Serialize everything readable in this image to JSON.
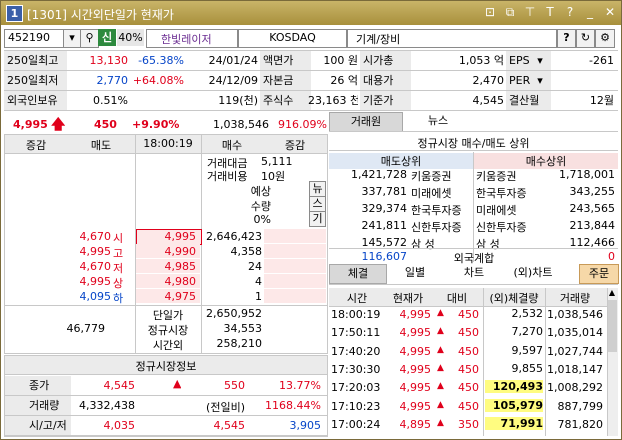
{
  "title": {
    "number": "1",
    "text": "[1301] 시간외단일가 현재가"
  },
  "toolbar": {
    "code": "452190",
    "sin": "신",
    "ratio": "40%",
    "stock_name": "한빛레이저",
    "market": "KOSDAQ",
    "sector": "기계/장비",
    "help": "?"
  },
  "summary": {
    "rows": [
      {
        "label": "250일최고",
        "price": "13,130",
        "pct": "-65.38%",
        "date": "24/01/24",
        "k1": "액면가",
        "v1": "100 원",
        "k2": "시가총",
        "v2": "1,053 억",
        "k3": "EPS",
        "v3": "-261"
      },
      {
        "label": "250일최저",
        "price": "2,770",
        "pct": "+64.08%",
        "date": "24/12/09",
        "k1": "자본금",
        "v1": "26 억",
        "k2": "대용가",
        "v2": "2,470",
        "k3": "PER",
        "v3": ""
      },
      {
        "label": "외국인보유",
        "price": "0.51%",
        "pct": "",
        "date": "119(천)",
        "k1": "주식수",
        "v1": "23,163 천",
        "k2": "기준가",
        "v2": "4,545",
        "k3": "결산월",
        "v3": "12월"
      }
    ]
  },
  "quote": {
    "price": "4,995",
    "change": "450",
    "rate": "+9.90%",
    "volume": "1,038,546",
    "vol_ratio": "916.09%"
  },
  "orderbook": {
    "headers": [
      "증감",
      "매도",
      "18:00:19",
      "매수",
      "증감"
    ],
    "amount_label": "거래대금",
    "amount": "5,111",
    "cost_label": "거래비용",
    "cost": "10원",
    "expected_labels": [
      "예상",
      "수량",
      "0%"
    ],
    "side_buttons": [
      "뉴",
      "스",
      "기"
    ],
    "stats": [
      {
        "value": "4,670",
        "label": "시"
      },
      {
        "value": "4,995",
        "label": "고"
      },
      {
        "value": "4,670",
        "label": "저"
      },
      {
        "value": "4,995",
        "label": "상"
      },
      {
        "value": "4,095",
        "label": "하"
      }
    ],
    "levels": [
      {
        "price": "4,995",
        "qty": "2,646,423"
      },
      {
        "price": "4,990",
        "qty": "4,358"
      },
      {
        "price": "4,985",
        "qty": "24"
      },
      {
        "price": "4,980",
        "qty": "4"
      },
      {
        "price": "4,975",
        "qty": "1"
      }
    ],
    "total_ask": "46,779",
    "rows_bottom": [
      {
        "label": "단일가",
        "value": "2,650,952"
      },
      {
        "label": "정규시장",
        "value": "34,553"
      },
      {
        "label": "시간외",
        "value": "258,210"
      }
    ]
  },
  "regular": {
    "title": "정규시장정보",
    "rows": [
      {
        "label": "종가",
        "a": "4,545",
        "b": "550",
        "c": "13.77%"
      },
      {
        "label": "거래량",
        "a": "4,332,438",
        "b": "(전일비)",
        "c": "1168.44%"
      },
      {
        "label": "시/고/저",
        "a": "4,035",
        "b": "4,545",
        "c": "3,905"
      }
    ]
  },
  "broker": {
    "tabs": [
      "거래원",
      "뉴스"
    ],
    "subtitle": "정규시장 매수/매도 상위",
    "sell_header": "매도상위",
    "buy_header": "매수상위",
    "rows": [
      {
        "sv": "1,421,728",
        "sn": "키움증권",
        "bn": "키움증권",
        "bv": "1,718,001"
      },
      {
        "sv": "337,781",
        "sn": "미래에셋",
        "bn": "한국투자증",
        "bv": "343,255"
      },
      {
        "sv": "329,374",
        "sn": "한국투자증",
        "bn": "미래에셋",
        "bv": "243,565"
      },
      {
        "sv": "241,811",
        "sn": "신한투자증",
        "bn": "신한투자증",
        "bv": "213,844"
      },
      {
        "sv": "145,572",
        "sn": "삼 성",
        "bn": "삼 성",
        "bv": "112,466"
      }
    ],
    "foreign_sell": "116,607",
    "foreign_label": "외국계합",
    "foreign_buy": "0"
  },
  "trades": {
    "tabs": [
      "체결",
      "일별",
      "차트",
      "(외)차트",
      "주문"
    ],
    "headers": [
      "시간",
      "현재가",
      "대비",
      "(외)체결량",
      "거래량"
    ],
    "rows": [
      {
        "time": "18:00:19",
        "price": "4,995",
        "diff": "450",
        "vol": "2,532",
        "acc": "1,038,546"
      },
      {
        "time": "17:50:11",
        "price": "4,995",
        "diff": "450",
        "vol": "7,270",
        "acc": "1,035,014"
      },
      {
        "time": "17:40:20",
        "price": "4,995",
        "diff": "450",
        "vol": "9,597",
        "acc": "1,027,744"
      },
      {
        "time": "17:30:30",
        "price": "4,995",
        "diff": "450",
        "vol": "9,855",
        "acc": "1,018,147"
      },
      {
        "time": "17:20:03",
        "price": "4,995",
        "diff": "450",
        "vol": "120,493",
        "acc": "1,008,292"
      },
      {
        "time": "17:10:23",
        "price": "4,995",
        "diff": "450",
        "vol": "105,979",
        "acc": "887,799"
      },
      {
        "time": "17:00:24",
        "price": "4,895",
        "diff": "350",
        "vol": "71,991",
        "acc": "781,820"
      }
    ]
  },
  "colors": {
    "up": "#e0001b",
    "down": "#0645c8",
    "titlebar": "#b39d4c",
    "highlight": "#fffc80"
  }
}
